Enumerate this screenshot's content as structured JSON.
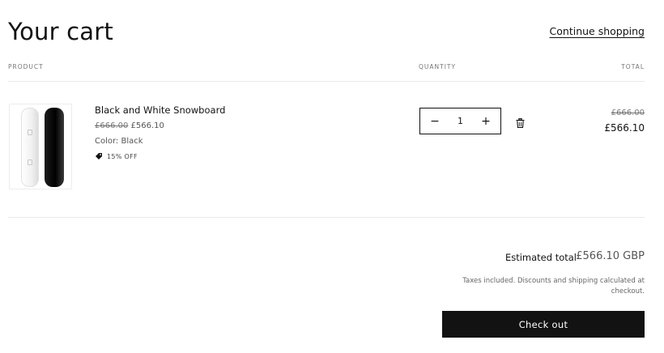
{
  "header": {
    "title": "Your cart",
    "continue_label": "Continue shopping"
  },
  "columns": {
    "product": "PRODUCT",
    "quantity": "QUANTITY",
    "total": "TOTAL"
  },
  "item": {
    "name": "Black and White Snowboard",
    "original_price": "£666.00",
    "sale_price": "£566.10",
    "color": "Color: Black",
    "discount": "15% OFF",
    "quantity": "1",
    "line_original": "£666.00",
    "line_total": "£566.10"
  },
  "summary": {
    "estimated_label": "Estimated total",
    "estimated_value": "£566.10 GBP",
    "tax_note": "Taxes included. Discounts and shipping calculated at checkout.",
    "checkout_label": "Check out"
  },
  "icons": {
    "minus": "minus-icon",
    "plus": "plus-icon",
    "trash": "trash-icon",
    "tag": "tag-icon"
  },
  "colors": {
    "text": "#121212",
    "button_bg": "#121212",
    "button_text": "#ffffff",
    "muted": "#777777"
  }
}
